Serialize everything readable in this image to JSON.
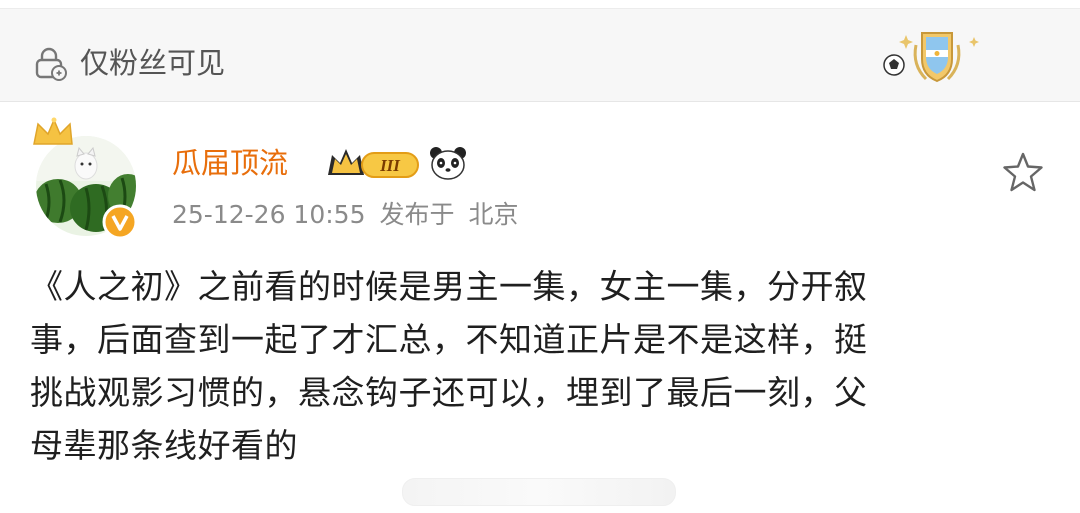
{
  "visibility": {
    "label": "仅粉丝可见"
  },
  "author": {
    "name": "瓜届顶流",
    "rank_numeral": "III"
  },
  "meta": {
    "datetime": "25-12-26 10:55",
    "location_prefix": "发布于",
    "location": "北京"
  },
  "post": {
    "lines": [
      "《人之初》之前看的时候是男主一集，女主一集，分开叙",
      "事，后面查到一起了才汇总，不知道正片是不是这样，挺",
      "挑战观影习惯的，悬念钩子还可以，埋到了最后一刻，父",
      "母辈那条线好看的"
    ]
  },
  "colors": {
    "username": "#e86e0b",
    "meta": "#8a8a8a",
    "bar_bg": "#f7f7f7",
    "verified": "#f5a623"
  },
  "icons": [
    "lock-icon",
    "football-badge-icon",
    "crown-icon",
    "verified-icon",
    "rank-badge-icon",
    "panda-icon",
    "star-icon"
  ]
}
